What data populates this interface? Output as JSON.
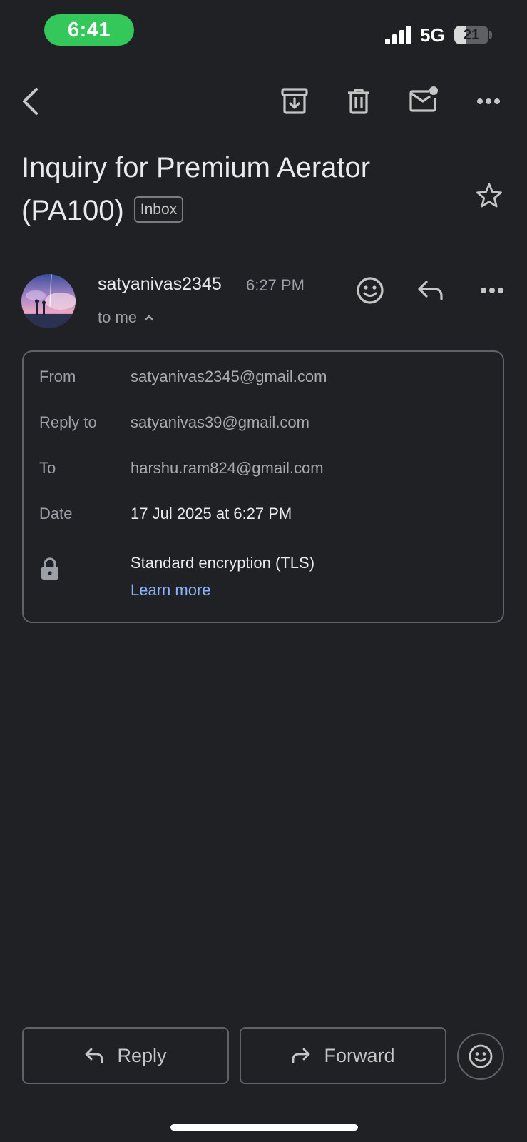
{
  "status_bar": {
    "time": "6:41",
    "network": "5G",
    "battery_level": "21",
    "battery_fraction": 0.21
  },
  "toolbar": {
    "icons": [
      "back-arrow-icon",
      "archive-icon",
      "delete-icon",
      "mark-unread-icon",
      "more-options-icon"
    ]
  },
  "email": {
    "subject": "Inquiry for Premium Aerator (PA100)",
    "label": "Inbox",
    "starred": false,
    "sender": {
      "name": "satyanivas2345",
      "time": "6:27 PM",
      "recipient_summary": "to me"
    },
    "details": {
      "from_label": "From",
      "from_value": "satyanivas2345@gmail.com",
      "reply_to_label": "Reply to",
      "reply_to_value": "satyanivas39@gmail.com",
      "to_label": "To",
      "to_value": "harshu.ram824@gmail.com",
      "date_label": "Date",
      "date_value": "17 Jul 2025 at 6:27 PM",
      "encryption_text": "Standard encryption (TLS)",
      "learn_more": "Learn more"
    }
  },
  "actions": {
    "reply_label": "Reply",
    "forward_label": "Forward"
  },
  "colors": {
    "background": "#202124",
    "accent_link": "#8ab4f8",
    "status_pill": "#34c759",
    "border": "#5f6368"
  }
}
